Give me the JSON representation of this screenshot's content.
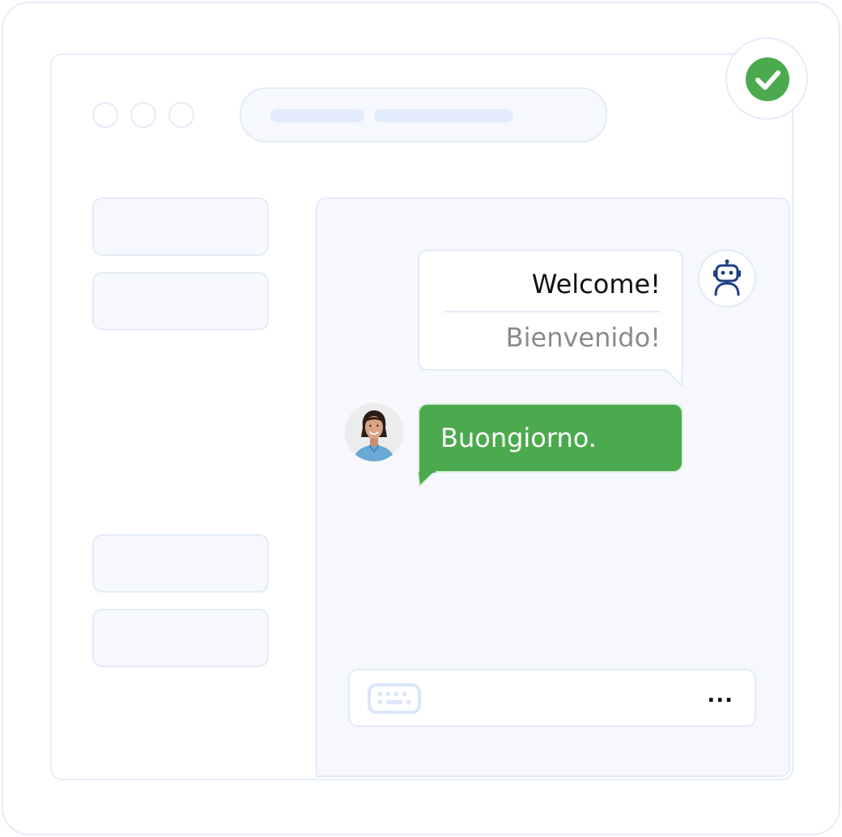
{
  "chat": {
    "bot_message": {
      "text": "Welcome!",
      "translation": "Bienvenido!"
    },
    "user_message": {
      "text": "Buongiorno."
    }
  },
  "composer": {
    "more_label": "..."
  },
  "icons": {
    "status": "check-circle-icon",
    "bot": "robot-icon",
    "input": "keyboard-icon"
  },
  "colors": {
    "accent_green": "#4caa4e",
    "bot_icon": "#1d3f86",
    "border": "#e3ebf8",
    "panel_background": "#f6f8fd"
  }
}
